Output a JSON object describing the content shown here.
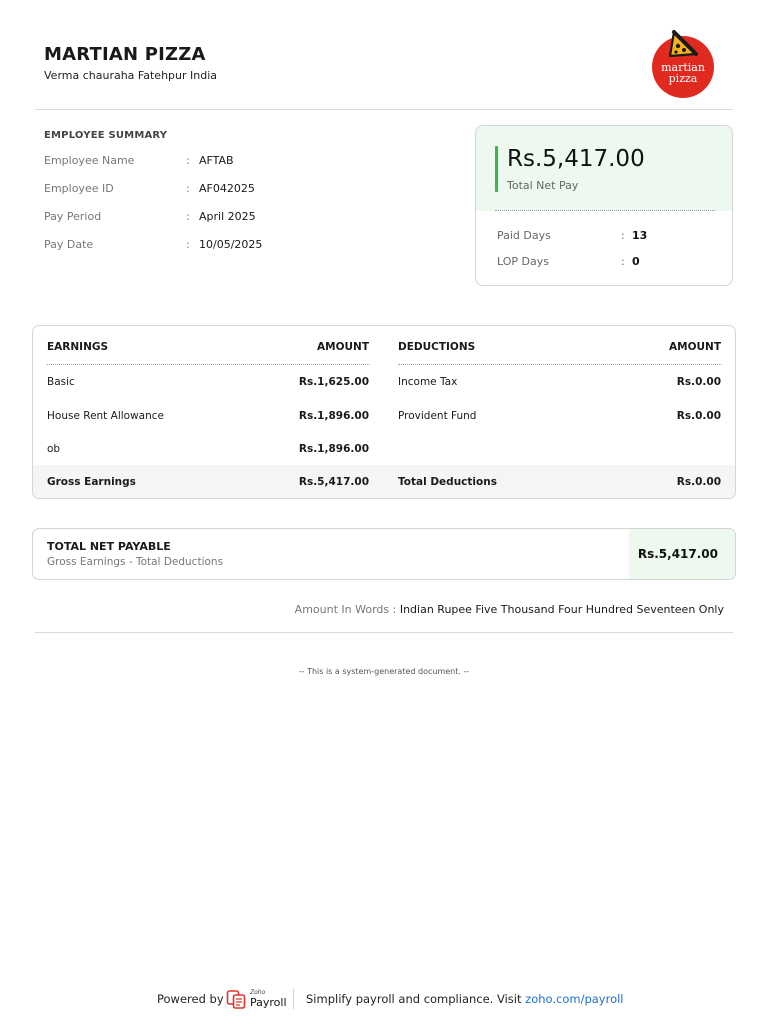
{
  "company": {
    "name": "MARTIAN PIZZA",
    "address": "Verma chauraha Fatehpur India",
    "logo_text": [
      "martian",
      "pizza"
    ],
    "brand_color": "#e02a20"
  },
  "summary": {
    "title": "EMPLOYEE SUMMARY",
    "rows": [
      {
        "label": "Employee Name",
        "value": "AFTAB"
      },
      {
        "label": "Employee ID",
        "value": "AF042025"
      },
      {
        "label": "Pay Period",
        "value": "April 2025"
      },
      {
        "label": "Pay Date",
        "value": "10/05/2025"
      }
    ],
    "separator": ":"
  },
  "net_card": {
    "amount": "Rs.5,417.00",
    "label": "Total Net Pay",
    "rows": [
      {
        "label": "Paid Days",
        "value": "13"
      },
      {
        "label": "LOP Days",
        "value": "0"
      }
    ],
    "accent_color": "#3cb54a"
  },
  "earnings": {
    "header": "EARNINGS",
    "amount_header": "AMOUNT",
    "rows": [
      {
        "label": "Basic",
        "amount": "Rs.1,625.00"
      },
      {
        "label": "House Rent Allowance",
        "amount": "Rs.1,896.00"
      },
      {
        "label": "ob",
        "amount": "Rs.1,896.00"
      }
    ],
    "total_label": "Gross Earnings",
    "total_amount": "Rs.5,417.00"
  },
  "deductions": {
    "header": "DEDUCTIONS",
    "amount_header": "AMOUNT",
    "rows": [
      {
        "label": "Income Tax",
        "amount": "Rs.0.00"
      },
      {
        "label": "Provident Fund",
        "amount": "Rs.0.00"
      }
    ],
    "total_label": "Total Deductions",
    "total_amount": "Rs.0.00"
  },
  "net_payable": {
    "title": "TOTAL NET PAYABLE",
    "subtitle": "Gross Earnings - Total Deductions",
    "amount": "Rs.5,417.00"
  },
  "amount_in_words": {
    "label": "Amount In Words :",
    "value": "Indian Rupee Five Thousand Four Hundred Seventeen Only"
  },
  "system_note": "-- This is a system-generated document. --",
  "footer": {
    "powered_by": "Powered by",
    "zoho_small": "Zoho",
    "zoho_product": "Payroll",
    "tagline": "Simplify payroll and compliance. Visit",
    "link": "zoho.com/payroll",
    "link_color": "#1e6fd0"
  }
}
